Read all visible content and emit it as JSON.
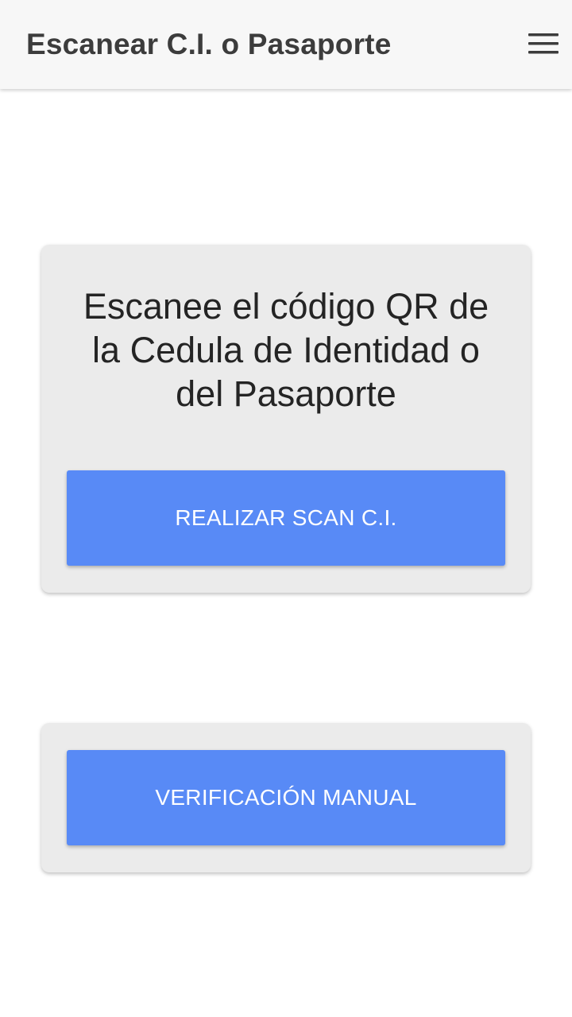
{
  "header": {
    "title": "Escanear C.I. o Pasaporte",
    "menu_icon": "hamburger-menu-icon"
  },
  "scan_card": {
    "instructions": "Escanee el código QR de la Cedula de Identidad o del Pasaporte",
    "button_label": "REALIZAR SCAN C.I."
  },
  "manual_card": {
    "button_label": "VERIFICACIÓN MANUAL"
  },
  "colors": {
    "accent": "#588af6",
    "card_background": "#ebebeb",
    "app_bar_background": "#f7f7f7"
  }
}
